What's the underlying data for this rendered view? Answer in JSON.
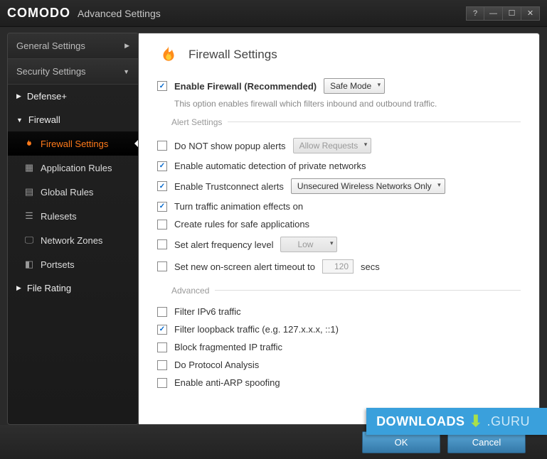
{
  "window": {
    "brand": "COMODO",
    "title": "Advanced Settings"
  },
  "winctrl": {
    "help": "?",
    "min": "—",
    "max": "☐",
    "close": "✕"
  },
  "sidebar": {
    "headers": {
      "general": "General Settings",
      "security": "Security Settings"
    },
    "items": {
      "defense": "Defense+",
      "firewall": "Firewall",
      "fw_settings": "Firewall Settings",
      "app_rules": "Application Rules",
      "global_rules": "Global Rules",
      "rulesets": "Rulesets",
      "network_zones": "Network Zones",
      "portsets": "Portsets",
      "file_rating": "File Rating"
    }
  },
  "page": {
    "title": "Firewall Settings",
    "enable": {
      "label": "Enable Firewall (Recommended)",
      "mode": "Safe Mode",
      "desc": "This option enables firewall which filters inbound and outbound traffic."
    },
    "group_alert": "Alert Settings",
    "group_advanced": "Advanced",
    "opts": {
      "no_popup": "Do NOT show popup alerts",
      "allow_requests": "Allow Requests",
      "auto_detect": "Enable automatic detection of private networks",
      "trustconnect": "Enable Trustconnect alerts",
      "trustconnect_mode": "Unsecured Wireless Networks Only",
      "traffic_anim": "Turn traffic animation effects on",
      "safe_rules": "Create rules for safe applications",
      "alert_freq": "Set alert frequency level",
      "alert_freq_val": "Low",
      "alert_timeout": "Set new on-screen alert timeout to",
      "alert_timeout_val": "120",
      "secs": "secs",
      "ipv6": "Filter IPv6 traffic",
      "loopback": "Filter loopback traffic (e.g. 127.x.x.x, ::1)",
      "fragmented": "Block fragmented IP traffic",
      "protocol": "Do Protocol Analysis",
      "antiarp": "Enable anti-ARP spoofing"
    }
  },
  "buttons": {
    "ok": "OK",
    "cancel": "Cancel"
  },
  "watermark": {
    "a": "DOWNLOADS",
    "b": ".GURU"
  }
}
